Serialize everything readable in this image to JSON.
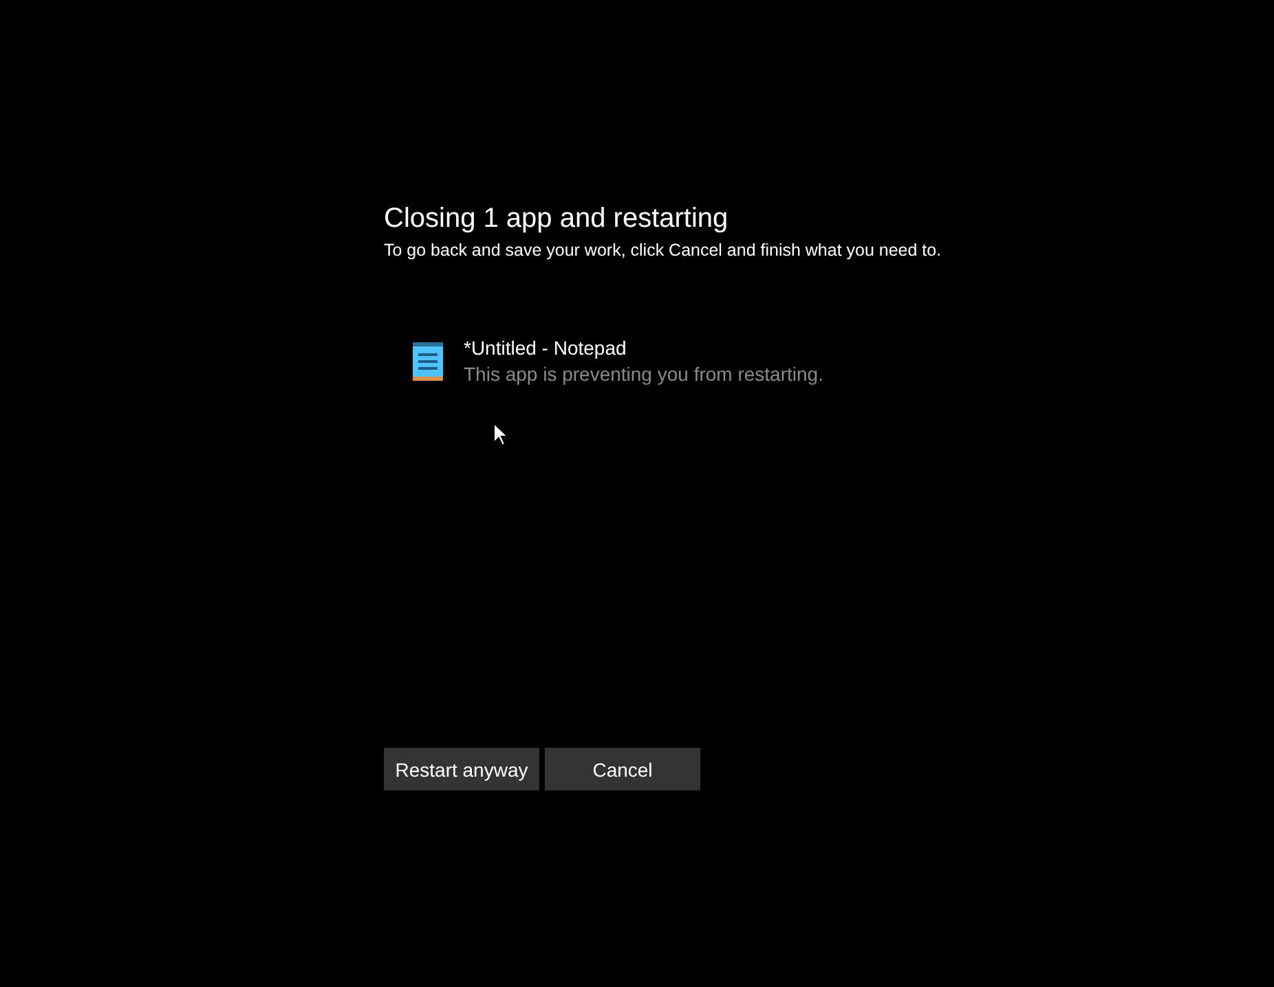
{
  "title": "Closing 1 app and restarting",
  "subtitle": "To go back and save your work, click Cancel and finish what you need to.",
  "apps": [
    {
      "name": "*Untitled - Notepad",
      "status": "This app is preventing you from restarting."
    }
  ],
  "buttons": [
    "Restart anyway",
    "Cancel"
  ]
}
